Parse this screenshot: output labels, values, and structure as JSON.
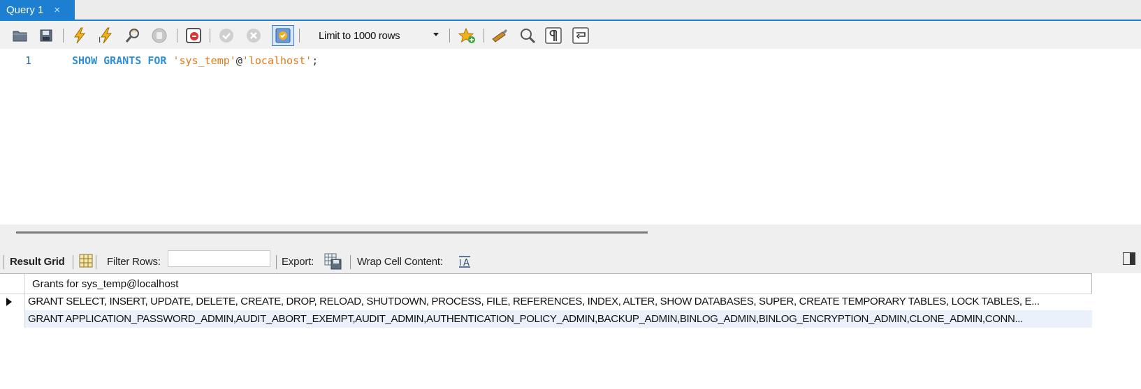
{
  "tab": {
    "title": "Query 1",
    "close_glyph": "×"
  },
  "toolbar": {
    "limit_label": "Limit to 1000 rows",
    "icons": [
      "open-file-icon",
      "save-icon",
      "execute-icon",
      "execute-current-icon",
      "explain-icon",
      "stop-icon",
      "toggle-stop-on-error-icon",
      "commit-icon",
      "rollback-icon",
      "autocommit-icon",
      "add-snippet-icon",
      "beautify-icon",
      "find-icon",
      "invisible-chars-icon",
      "word-wrap-icon"
    ]
  },
  "editor": {
    "line_number": "1",
    "kw_show": "SHOW",
    "kw_grants": "GRANTS",
    "kw_for": "FOR",
    "user": "'sys_temp'",
    "at": "@",
    "host": "'localhost'",
    "semicolon": ";"
  },
  "results": {
    "result_grid_label": "Result Grid",
    "filter_rows_label": "Filter Rows:",
    "filter_value": "",
    "export_label": "Export:",
    "wrap_label": "Wrap Cell Content:",
    "column_header": "Grants for sys_temp@localhost",
    "rows": [
      "GRANT SELECT, INSERT, UPDATE, DELETE, CREATE, DROP, RELOAD, SHUTDOWN, PROCESS, FILE, REFERENCES, INDEX, ALTER, SHOW DATABASES, SUPER, CREATE TEMPORARY TABLES, LOCK TABLES, E...",
      "GRANT APPLICATION_PASSWORD_ADMIN,AUDIT_ABORT_EXEMPT,AUDIT_ADMIN,AUTHENTICATION_POLICY_ADMIN,BACKUP_ADMIN,BINLOG_ADMIN,BINLOG_ENCRYPTION_ADMIN,CLONE_ADMIN,CONN..."
    ]
  },
  "colors": {
    "accent": "#1d7fd1",
    "keyword": "#2f8fd8",
    "string": "#e07a1a",
    "selected_row": "#eaf1fb"
  }
}
